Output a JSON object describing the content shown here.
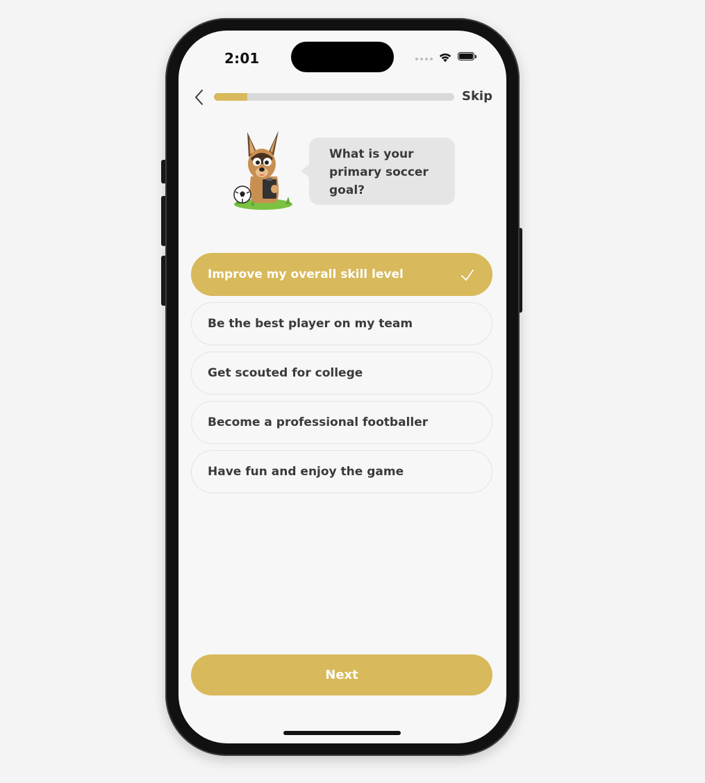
{
  "status_bar": {
    "time": "2:01"
  },
  "nav": {
    "back_icon": "chevron-left-icon",
    "skip_label": "Skip",
    "progress": 0.14
  },
  "prompt": {
    "question": "What is your primary soccer goal?"
  },
  "options": [
    {
      "label": "Improve my overall skill level",
      "selected": true
    },
    {
      "label": "Be the best player on my team",
      "selected": false
    },
    {
      "label": "Get scouted for college",
      "selected": false
    },
    {
      "label": "Become a professional footballer",
      "selected": false
    },
    {
      "label": "Have fun and enjoy the game",
      "selected": false
    }
  ],
  "footer": {
    "next_label": "Next"
  },
  "colors": {
    "accent": "#d8b95b",
    "text": "#3a3a3a",
    "background": "#f7f7f7",
    "bubble": "#e5e5e5"
  }
}
